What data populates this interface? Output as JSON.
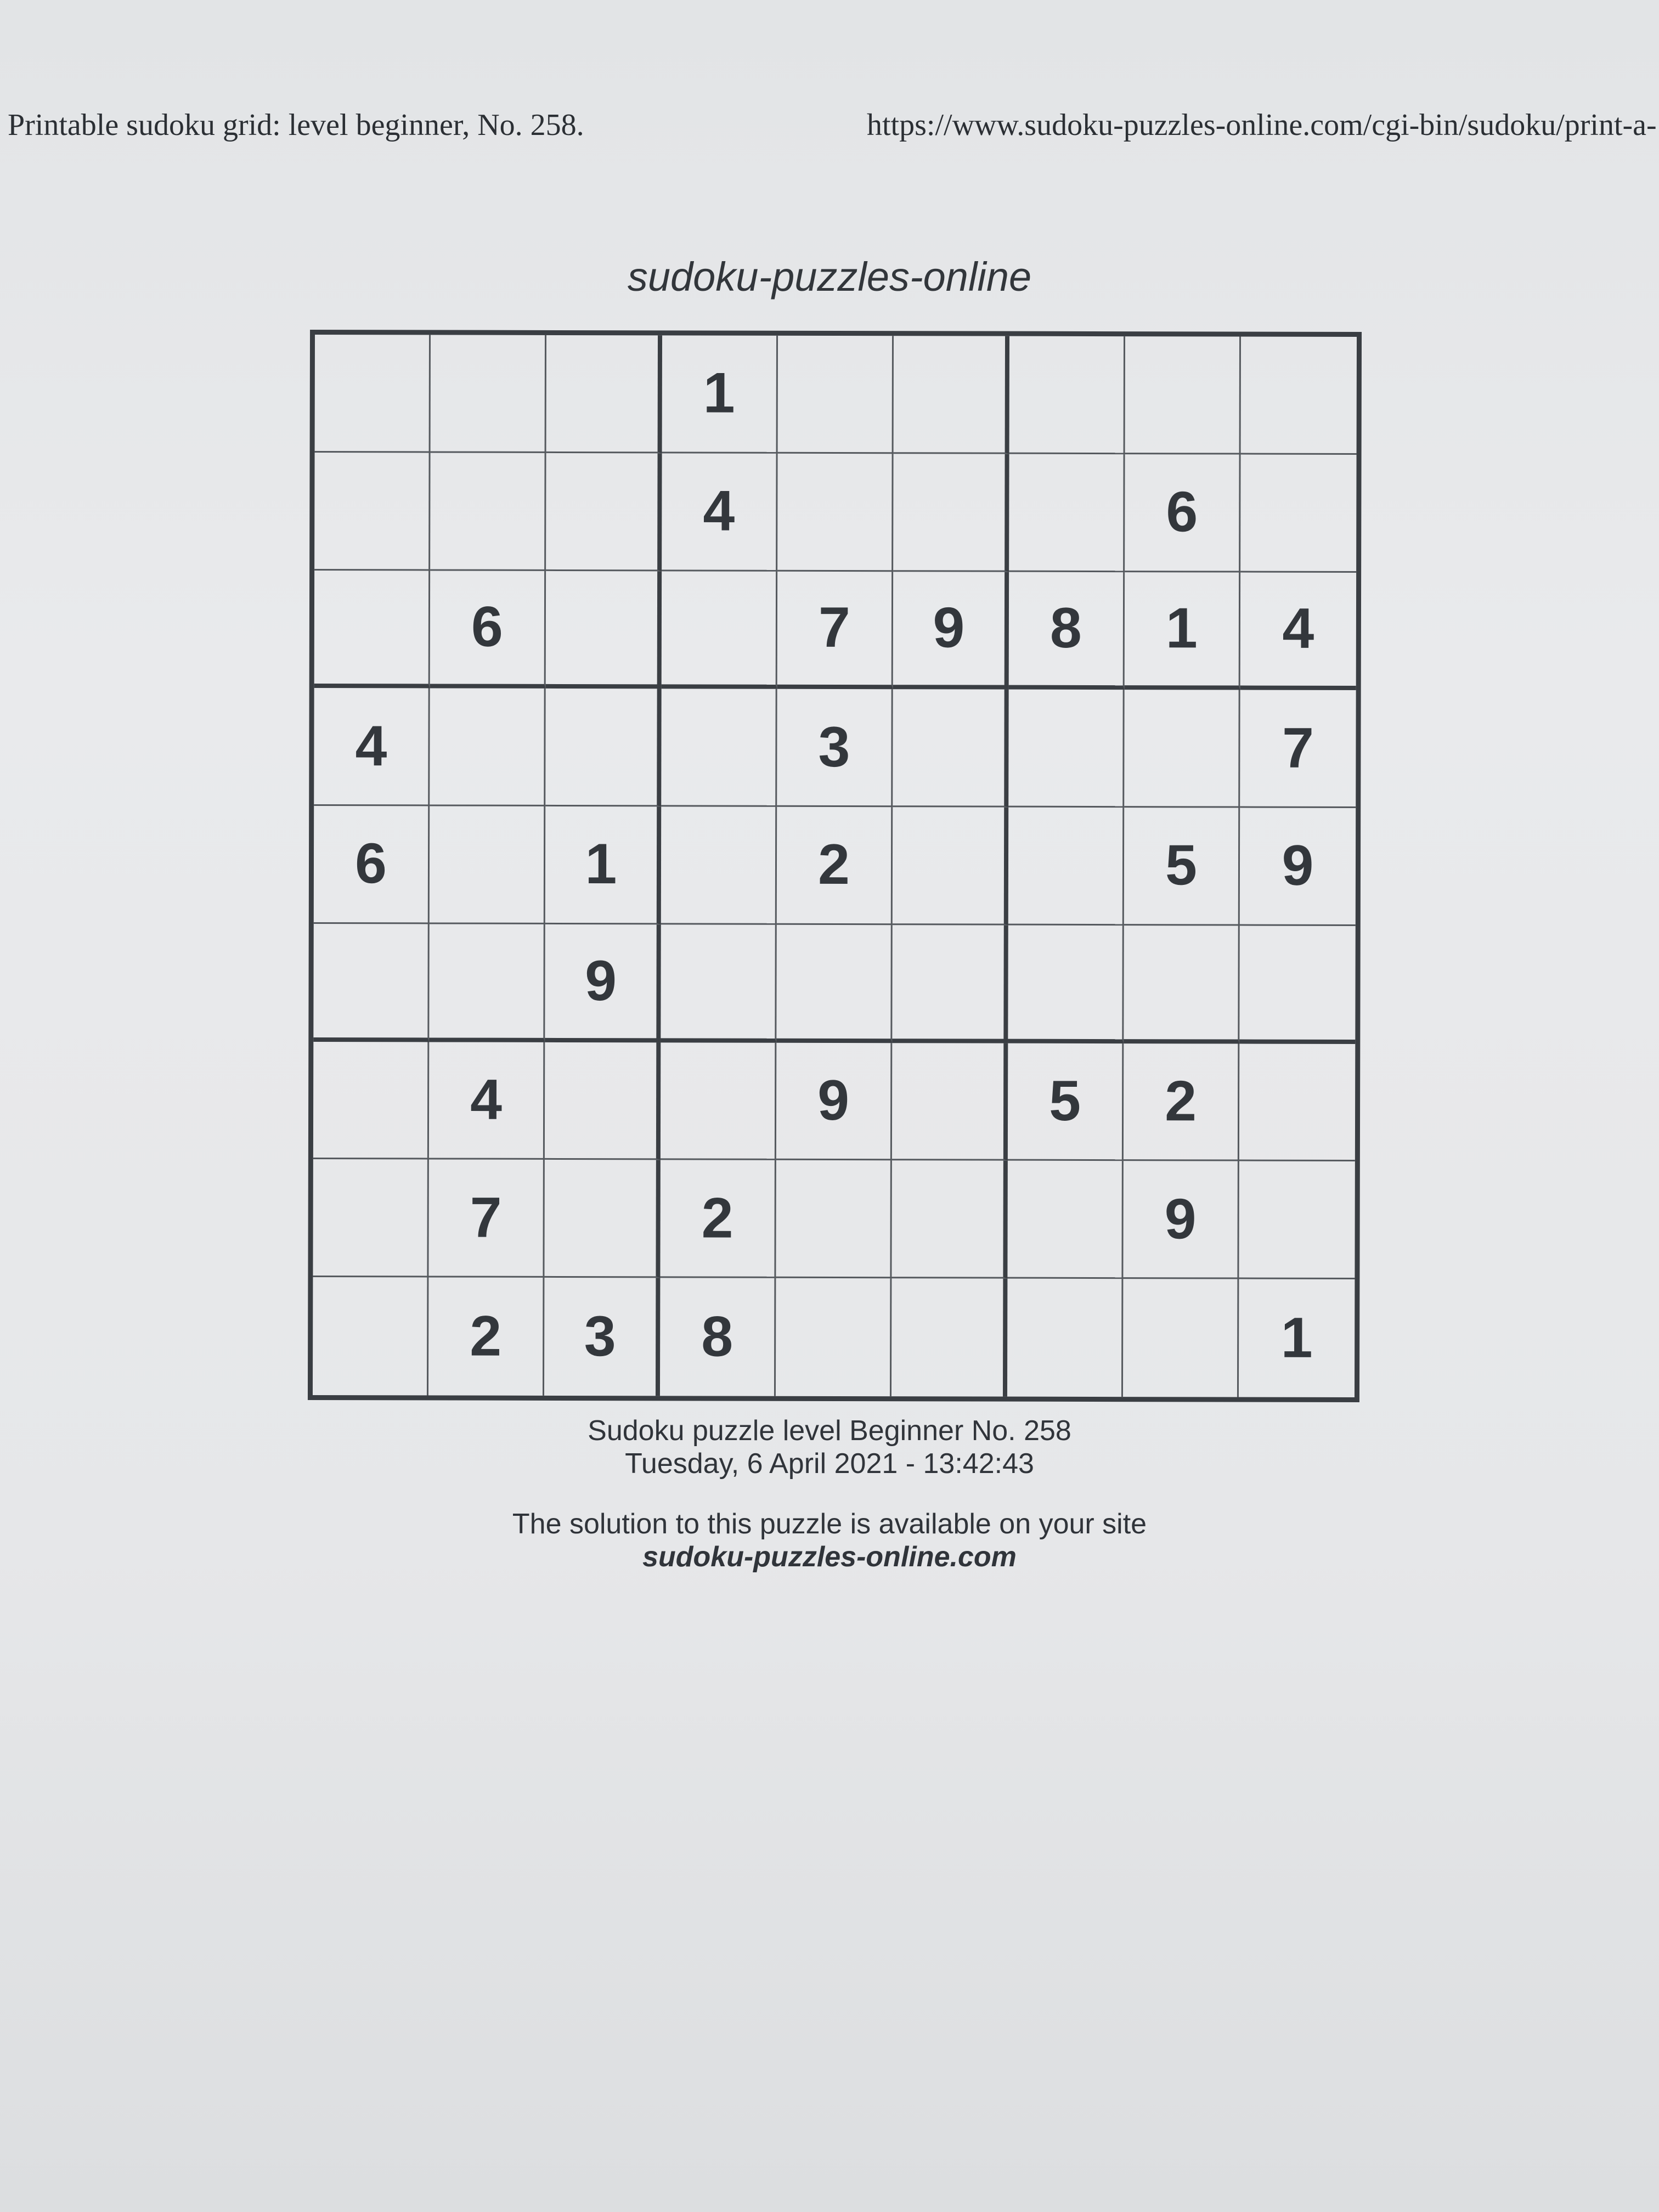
{
  "header": {
    "left_text": "Printable sudoku grid: level beginner, No. 258.",
    "right_text": "https://www.sudoku-puzzles-online.com/cgi-bin/sudoku/print-a-"
  },
  "site_title": "sudoku-puzzles-online",
  "grid": [
    [
      "",
      "",
      "",
      "1",
      "",
      "",
      "",
      "",
      ""
    ],
    [
      "",
      "",
      "",
      "4",
      "",
      "",
      "",
      "6",
      ""
    ],
    [
      "",
      "6",
      "",
      "",
      "7",
      "9",
      "8",
      "1",
      "4"
    ],
    [
      "4",
      "",
      "",
      "",
      "3",
      "",
      "",
      "",
      "7"
    ],
    [
      "6",
      "",
      "1",
      "",
      "2",
      "",
      "",
      "5",
      "9"
    ],
    [
      "",
      "",
      "9",
      "",
      "",
      "",
      "",
      "",
      ""
    ],
    [
      "",
      "4",
      "",
      "",
      "9",
      "",
      "5",
      "2",
      ""
    ],
    [
      "",
      "7",
      "",
      "2",
      "",
      "",
      "",
      "9",
      ""
    ],
    [
      "",
      "2",
      "3",
      "8",
      "",
      "",
      "",
      "",
      "1"
    ]
  ],
  "footer": {
    "level_line": "Sudoku puzzle level Beginner No. 258",
    "date_line": "Tuesday, 6 April 2021 - 13:42:43",
    "solution_line": "The solution to this puzzle is available on your site",
    "site_line": "sudoku-puzzles-online.com"
  }
}
